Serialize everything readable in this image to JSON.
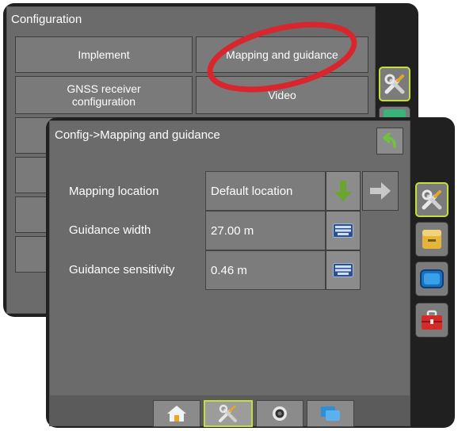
{
  "back_window": {
    "title": "Configuration",
    "buttons": [
      "Implement",
      "Mapping and guidance",
      "GNSS receiver configuration",
      "Video"
    ]
  },
  "front_window": {
    "title": "Config->Mapping and guidance",
    "rows": [
      {
        "label": "Mapping location",
        "value": "Default location"
      },
      {
        "label": "Guidance width",
        "value": "27.00 m"
      },
      {
        "label": "Guidance sensitivity",
        "value": "0.46 m"
      }
    ]
  },
  "icons": {
    "back": "back-arrow-icon",
    "download": "green-down-arrow-icon",
    "next": "gray-right-arrow-icon",
    "keyboard": "keyboard-icon",
    "tools": "tools-icon",
    "console": "console-icon",
    "display": "display-icon",
    "toolbox": "toolbox-icon",
    "home": "home-icon",
    "camera": "camera-icon",
    "data": "data-icon"
  },
  "colors": {
    "accent": "#c6dd3c",
    "highlight_circle": "#d8262c",
    "download_green": "#6aa52d"
  }
}
